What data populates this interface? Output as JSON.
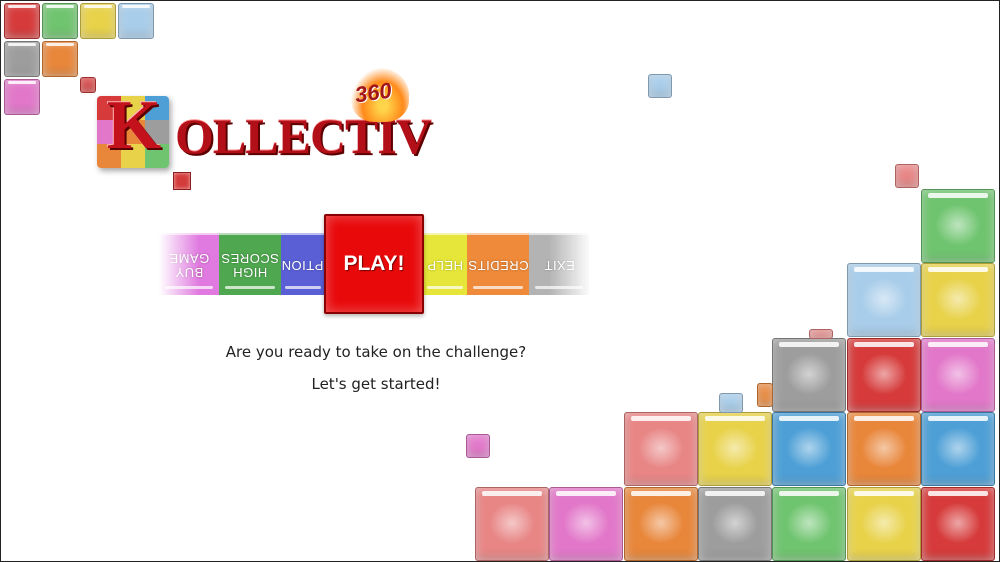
{
  "game": {
    "logo": {
      "letter": "K",
      "rest": "OLLECTIV",
      "badge": "360"
    },
    "menu": [
      {
        "id": "buy-game",
        "label": "BUY\nGAME",
        "color": "#e07ae0"
      },
      {
        "id": "high-scores",
        "label": "HIGH\nSCORES",
        "color": "#4fa84f"
      },
      {
        "id": "options",
        "label": "OPTIONS",
        "color": "#5a5fd6"
      },
      {
        "id": "help",
        "label": "HELP",
        "color": "#e6e63a"
      },
      {
        "id": "credits",
        "label": "CREDITS",
        "color": "#ef8a3a"
      },
      {
        "id": "exit",
        "label": "EXIT",
        "color": "#b3b3b3"
      }
    ],
    "play_label": "PLAY!",
    "play_color": "#e8090b",
    "message_line1": "Are you ready to take on the challenge?",
    "message_line2": "Let's get started!"
  },
  "palette": {
    "red": "#d63a3a",
    "green": "#6fc46f",
    "yellow": "#e8d24a",
    "blue": "#4d9fd6",
    "orange": "#e8863a",
    "gray": "#9d9d9d",
    "pink": "#e277c9",
    "lightblue": "#a8cdea",
    "salmon": "#e88585"
  }
}
